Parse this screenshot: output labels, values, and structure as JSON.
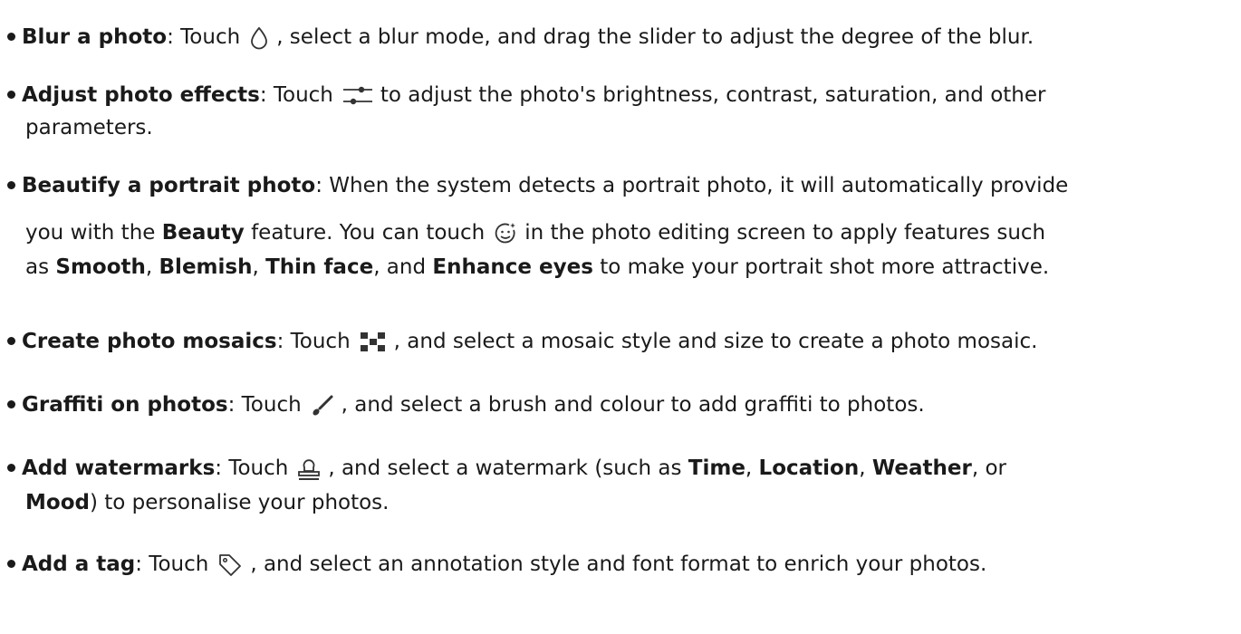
{
  "items": [
    {
      "title": "Blur a photo",
      "icon": "droplet-icon",
      "pre": ": Touch",
      "post": ", select a blur mode, and drag the slider to adjust the degree of the blur."
    },
    {
      "title": "Adjust photo effects",
      "icon": "adjust-sliders-icon",
      "pre": ": Touch",
      "post1": "to adjust the photo's brightness, contrast, saturation, and other",
      "post2": "parameters."
    },
    {
      "title": "Beautify a portrait photo",
      "line1_rest": ": When the system detects a portrait photo, it will automatically provide",
      "line2_pre": "you with the",
      "line2_bold": "Beauty",
      "line2_mid": "feature. You can touch",
      "icon": "beauty-face-icon",
      "line2_post": "in the photo editing screen to apply features such",
      "line3_pre": "as",
      "f1": "Smooth",
      "sep1": ",",
      "f2": "Blemish",
      "sep2": ",",
      "f3": "Thin face",
      "sep3": ", and",
      "f4": "Enhance eyes",
      "line3_post": "to make your portrait shot more attractive."
    },
    {
      "title": "Create photo mosaics",
      "icon": "mosaic-icon",
      "pre": ": Touch",
      "post": ", and select a mosaic style and size to create a photo mosaic."
    },
    {
      "title": "Graffiti on photos",
      "icon": "brush-icon",
      "pre": ": Touch",
      "post": ", and select a brush and colour to add graffiti to photos."
    },
    {
      "title": "Add watermarks",
      "icon": "watermark-stamp-icon",
      "pre": ": Touch",
      "post1": ", and select a watermark (such as",
      "w1": "Time",
      "sep1": ",",
      "w2": "Location",
      "sep2": ",",
      "w3": "Weather",
      "sep3": ", or",
      "w4": "Mood",
      "post2": ") to personalise your photos."
    },
    {
      "title": "Add a tag",
      "icon": "tag-icon",
      "pre": ": Touch",
      "post": ", and select an annotation style and font format to enrich your photos."
    }
  ]
}
